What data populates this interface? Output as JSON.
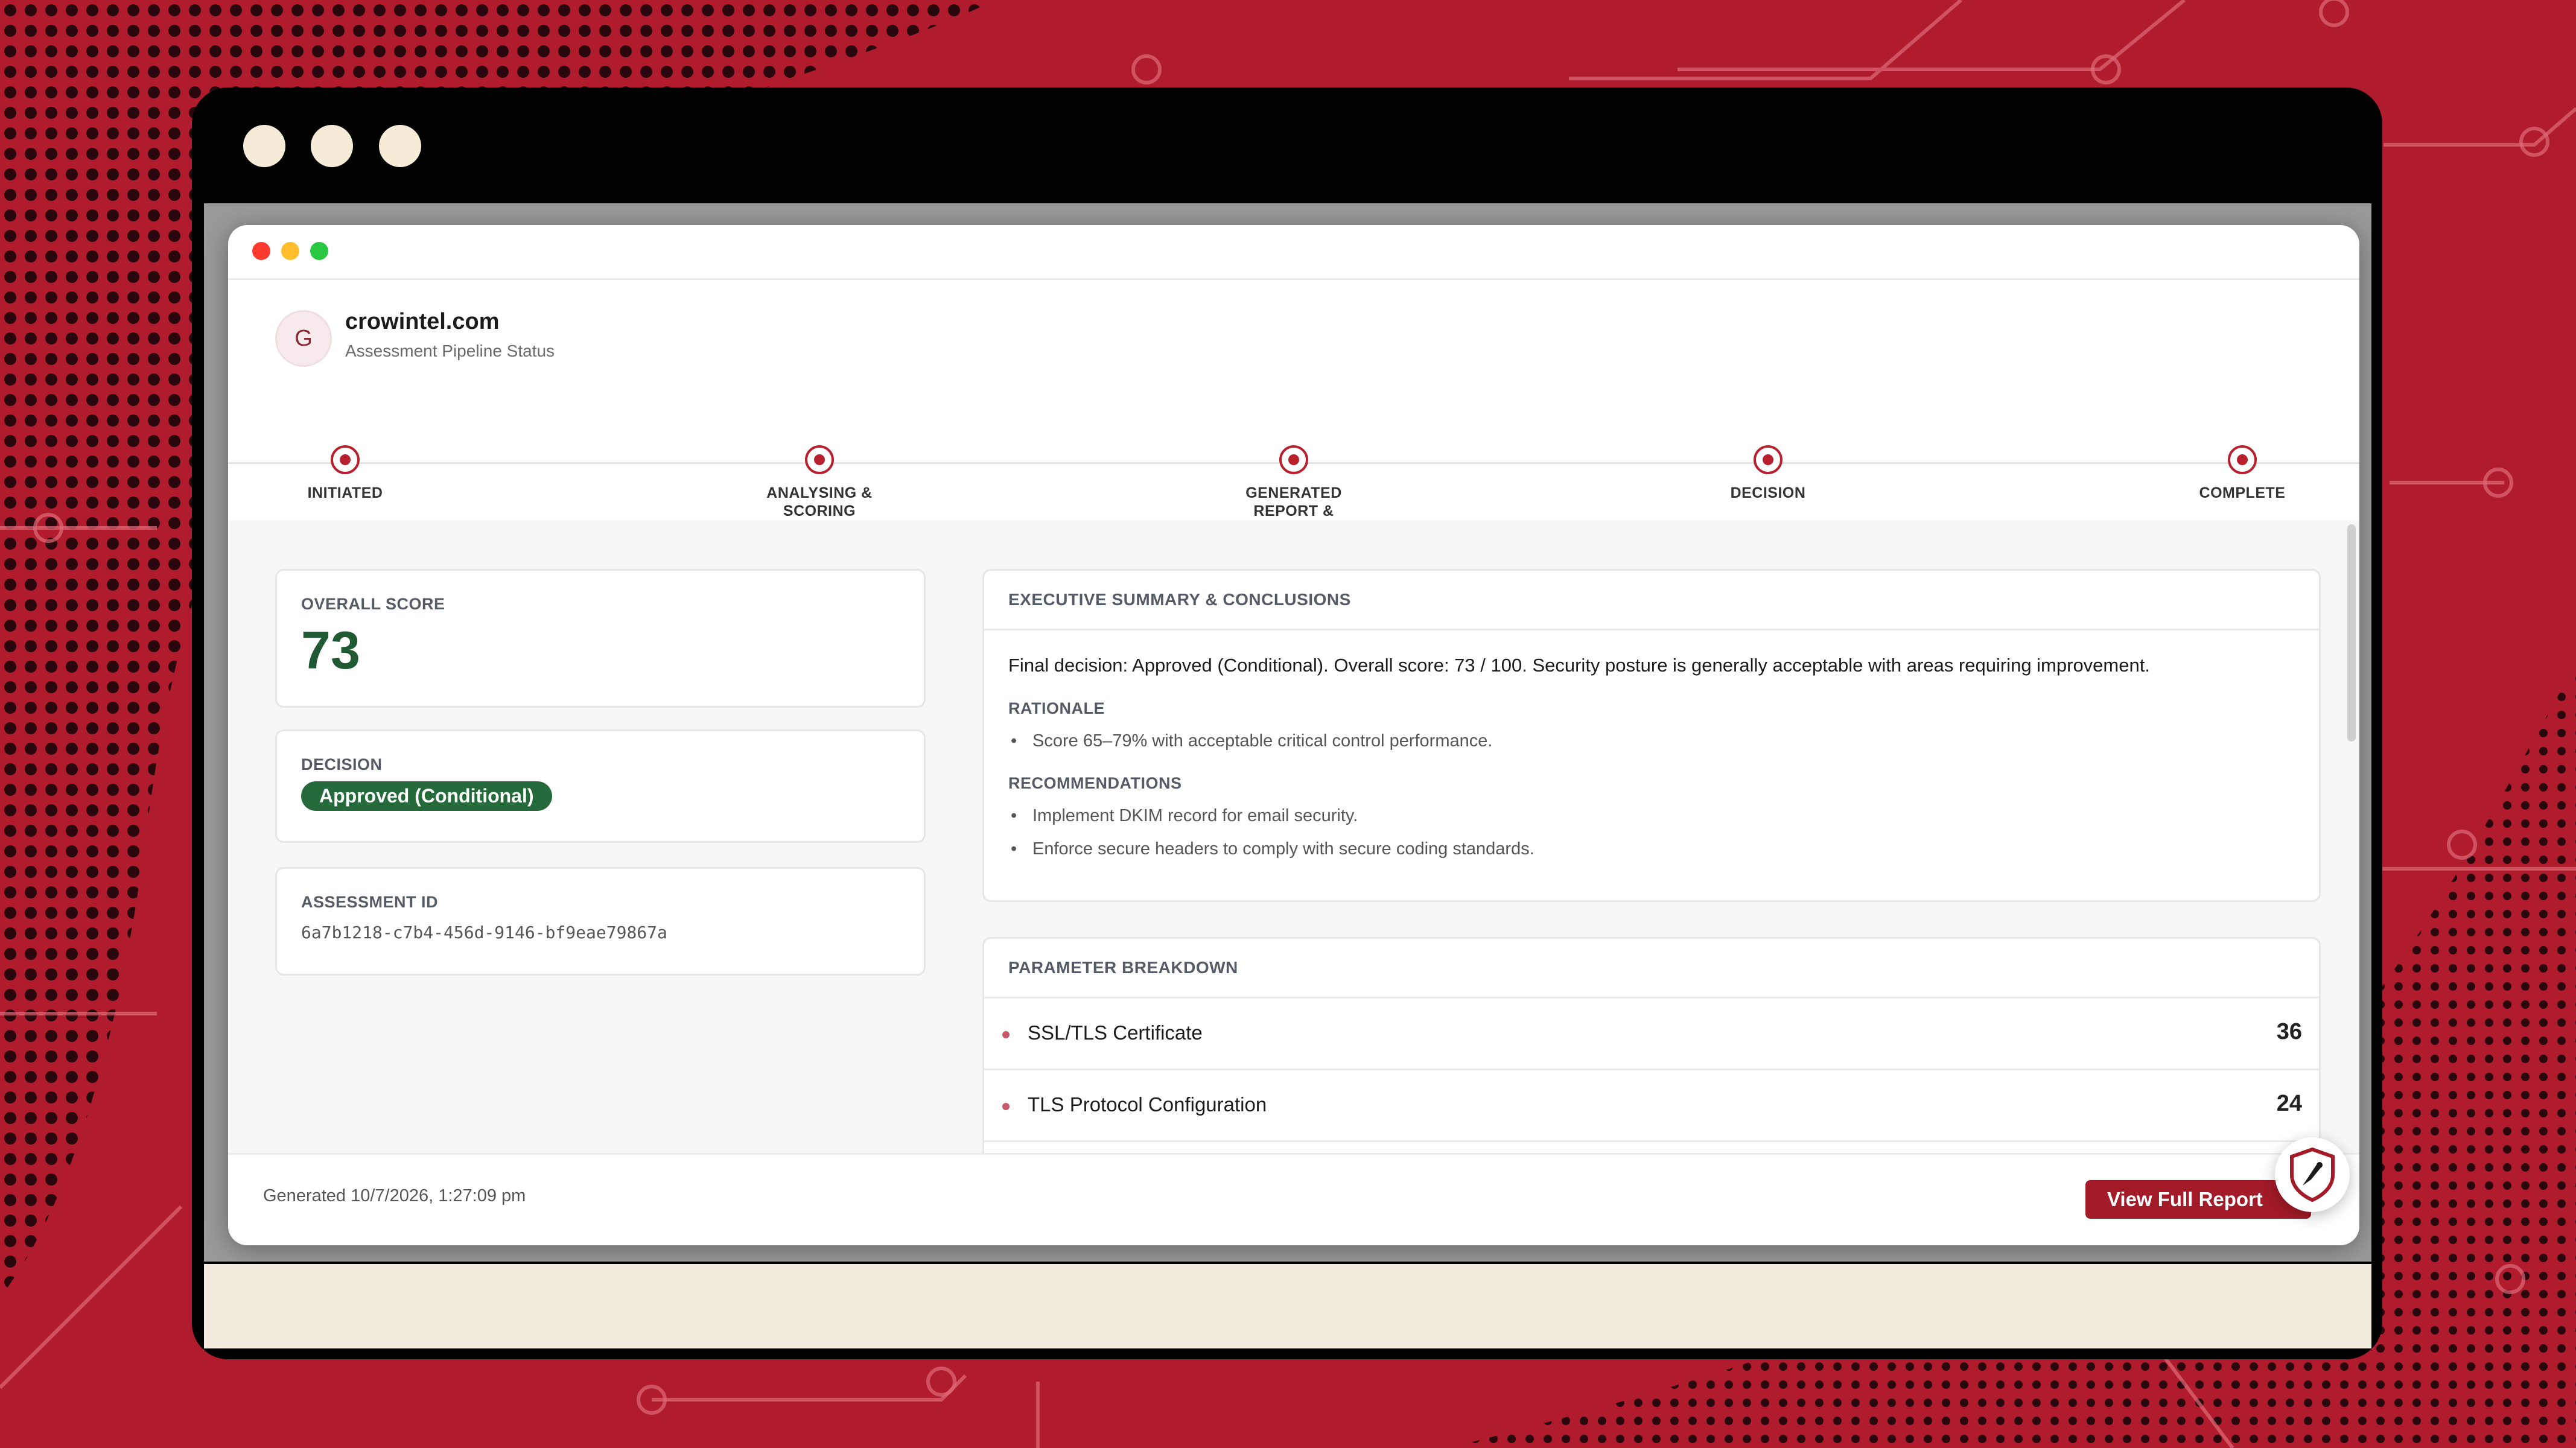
{
  "colors": {
    "background": "#b01b2e",
    "accent": "#b8202e",
    "approved_badge": "#256a3a",
    "score": "#1f5a33",
    "primary_button": "#a31a28"
  },
  "header": {
    "avatar_letter": "G",
    "domain": "crowintel.com",
    "subtitle": "Assessment Pipeline Status"
  },
  "pipeline": {
    "steps": [
      {
        "label": "INITIATED"
      },
      {
        "label": "ANALYSING & SCORING"
      },
      {
        "label": "GENERATED REPORT & ARTIFACT FILES"
      },
      {
        "label": "DECISION"
      },
      {
        "label": "COMPLETE"
      }
    ]
  },
  "left": {
    "score_label": "OVERALL SCORE",
    "score_value": "73",
    "decision_label": "DECISION",
    "decision_value": "Approved (Conditional)",
    "assessment_label": "ASSESSMENT ID",
    "assessment_id": "6a7b1218-c7b4-456d-9146-bf9eae79867a"
  },
  "executive": {
    "title": "EXECUTIVE SUMMARY & CONCLUSIONS",
    "final_decision": "Final decision: Approved (Conditional). Overall score: 73 / 100. Security posture is generally acceptable with areas requiring improvement.",
    "rationale_title": "RATIONALE",
    "rationale": [
      "Score 65–79% with acceptable critical control performance."
    ],
    "recommendations_title": "RECOMMENDATIONS",
    "recommendations": [
      "Implement DKIM record for email security.",
      "Enforce secure headers to comply with secure coding standards."
    ]
  },
  "parameters": {
    "title": "PARAMETER BREAKDOWN",
    "rows": [
      {
        "name": "SSL/TLS Certificate",
        "value": "36"
      },
      {
        "name": "TLS Protocol Configuration",
        "value": "24"
      }
    ]
  },
  "footer": {
    "generated": "Generated 10/7/2026, 1:27:09 pm",
    "view_button": "View Full Report",
    "view_chevron": "›"
  },
  "icons": {
    "window_controls": [
      "close-dot",
      "minimize-dot",
      "maximize-dot"
    ],
    "floating_action": "crow-shield-icon"
  }
}
